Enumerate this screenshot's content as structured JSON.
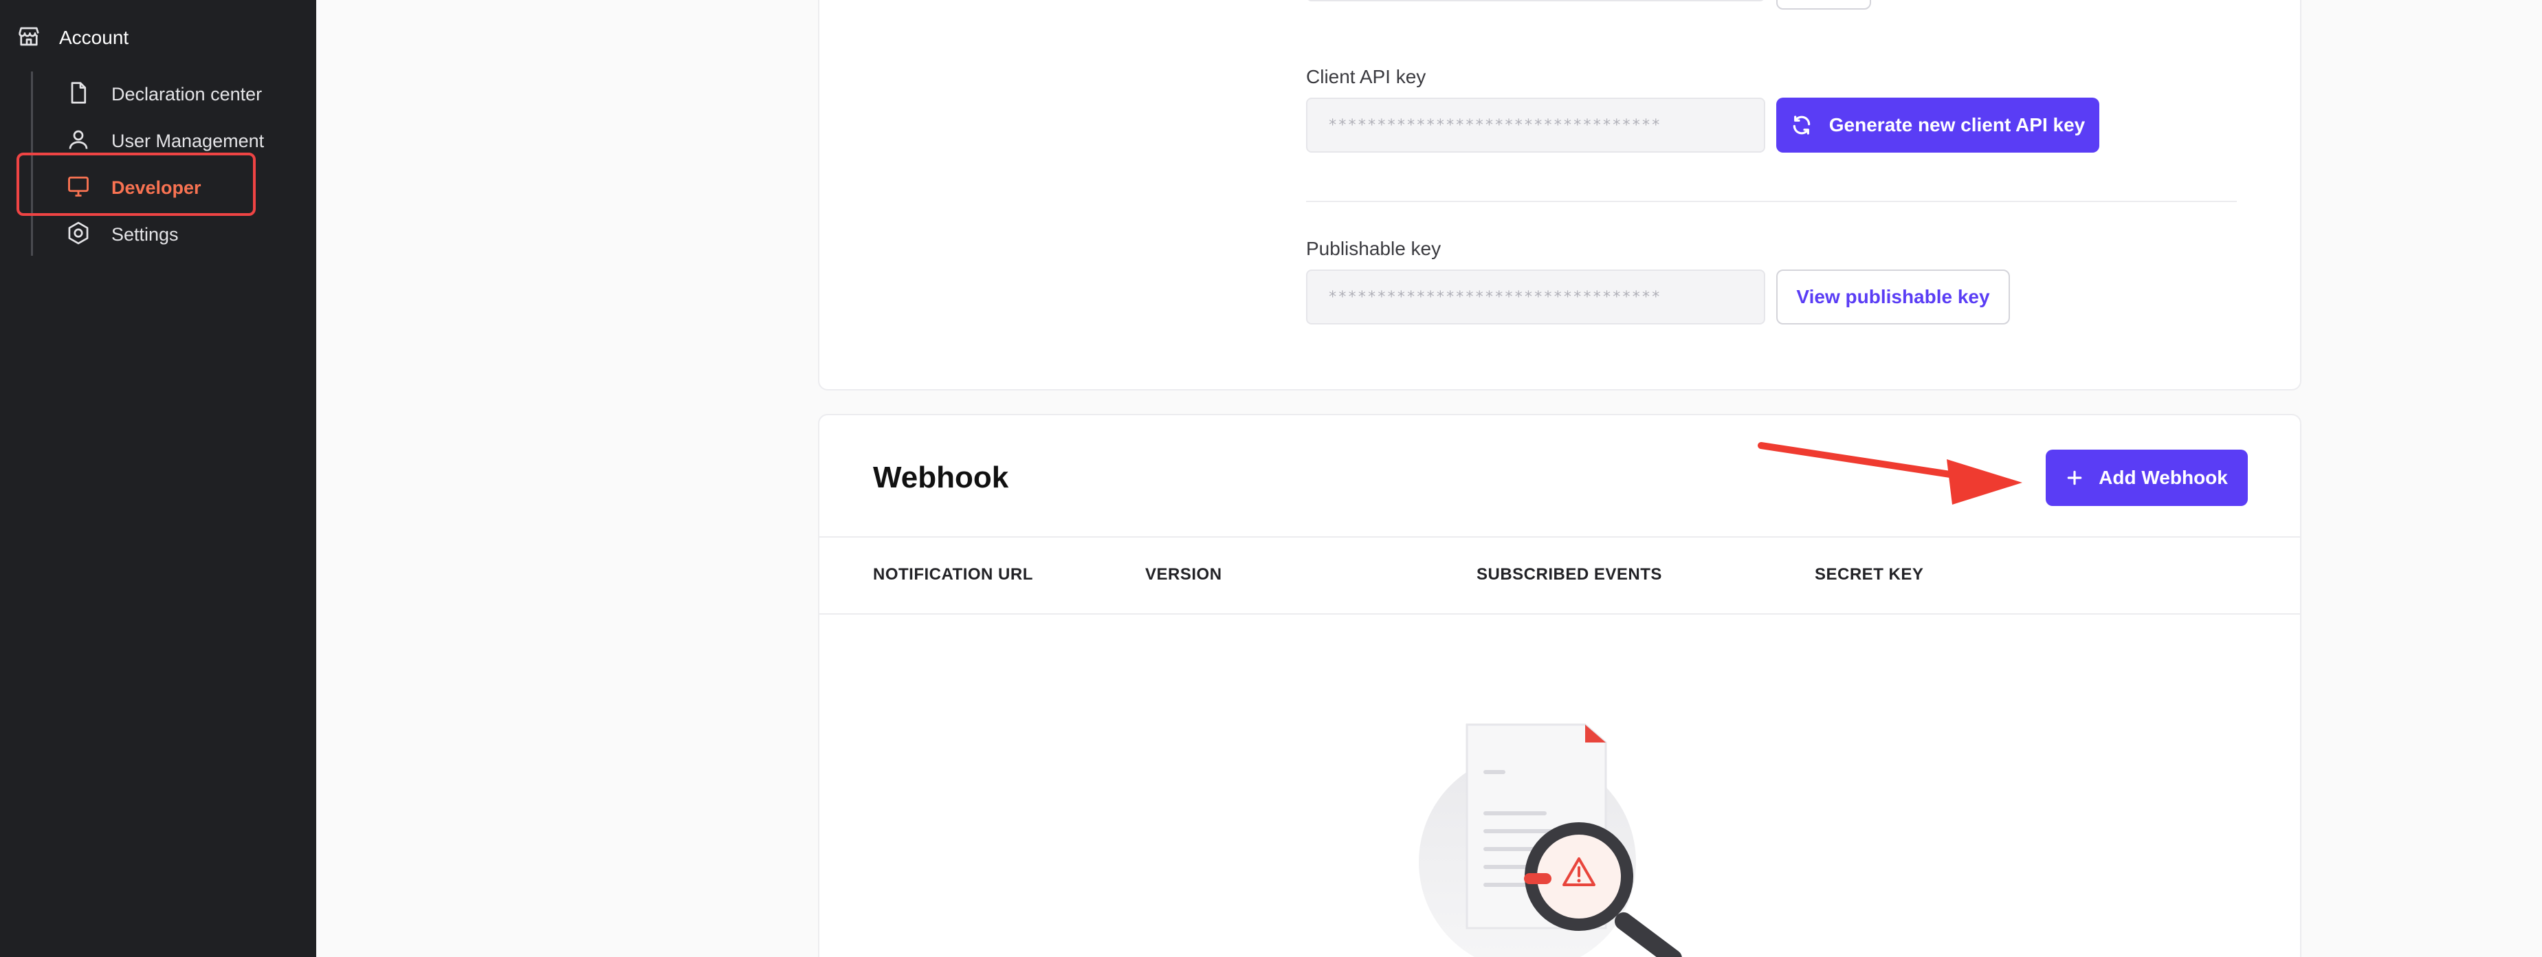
{
  "sidebar": {
    "section_title": "Account",
    "section_icon": "store-icon",
    "items": [
      {
        "label": "Declaration center",
        "icon": "document-icon"
      },
      {
        "label": "User Management",
        "icon": "user-icon"
      },
      {
        "label": "Developer",
        "icon": "monitor-icon",
        "active": true
      },
      {
        "label": "Settings",
        "icon": "gear-icon"
      }
    ]
  },
  "keys_card": {
    "client_api_key": {
      "label": "Client API key",
      "value": "**********************************",
      "button_label": "Generate new client API key"
    },
    "publishable_key": {
      "label": "Publishable key",
      "value": "**********************************",
      "button_label": "View publishable key"
    }
  },
  "webhook": {
    "title": "Webhook",
    "add_button_label": "Add Webhook",
    "columns": [
      "NOTIFICATION URL",
      "VERSION",
      "SUBSCRIBED EVENTS",
      "SECRET KEY"
    ]
  },
  "colors": {
    "accent": "#5a3df5",
    "active_nav": "#f97352",
    "annotation": "#ef4444",
    "sidebar_bg": "#1f2023"
  }
}
